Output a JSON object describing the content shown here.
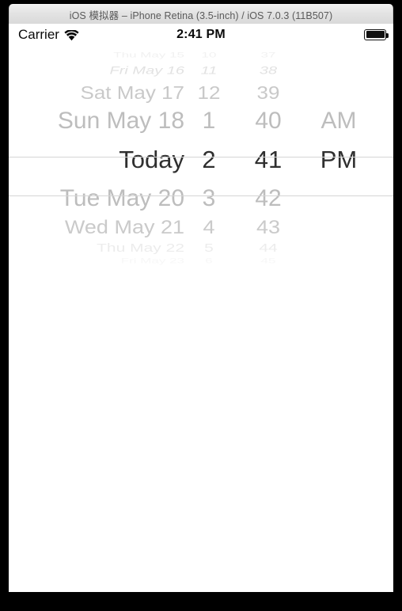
{
  "window": {
    "title": "iOS 模拟器 – iPhone Retina (3.5-inch) / iOS 7.0.3 (11B507)"
  },
  "status_bar": {
    "carrier": "Carrier",
    "wifi_icon": "wifi-icon",
    "time": "2:41 PM",
    "battery_icon": "battery-full-icon"
  },
  "date_picker": {
    "rows": [
      {
        "date": "Thu May 15",
        "hour": "10",
        "minute": "37",
        "ampm": "",
        "selected": false
      },
      {
        "date": "Fri May 16",
        "hour": "11",
        "minute": "38",
        "ampm": "",
        "selected": false
      },
      {
        "date": "Sat May 17",
        "hour": "12",
        "minute": "39",
        "ampm": "",
        "selected": false
      },
      {
        "date": "Sun May 18",
        "hour": "1",
        "minute": "40",
        "ampm": "AM",
        "selected": false
      },
      {
        "date": "Today",
        "hour": "2",
        "minute": "41",
        "ampm": "PM",
        "selected": true
      },
      {
        "date": "Tue May 20",
        "hour": "3",
        "minute": "42",
        "ampm": "",
        "selected": false
      },
      {
        "date": "Wed May 21",
        "hour": "4",
        "minute": "43",
        "ampm": "",
        "selected": false
      },
      {
        "date": "Thu May 22",
        "hour": "5",
        "minute": "44",
        "ampm": "",
        "selected": false
      },
      {
        "date": "Fri May 23",
        "hour": "6",
        "minute": "45",
        "ampm": "",
        "selected": false
      }
    ],
    "selected_index": 4,
    "selected_value": "Today 2 41 PM"
  },
  "colors": {
    "selected_text": "#2f2f2f",
    "unselected_text": "#bdbdbd",
    "separator": "#d5d5d5",
    "screen_background": "#ffffff",
    "bezel": "#000000"
  }
}
